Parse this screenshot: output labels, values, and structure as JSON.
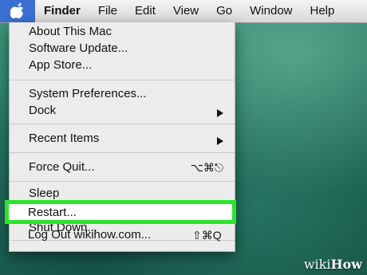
{
  "menubar": {
    "apple_icon": "apple-logo-icon",
    "items": [
      "Finder",
      "File",
      "Edit",
      "View",
      "Go",
      "Window",
      "Help"
    ]
  },
  "apple_menu": {
    "items": [
      {
        "label": "About This Mac"
      },
      {
        "label": "Software Update..."
      },
      {
        "label": "App Store..."
      },
      {
        "label": "System Preferences..."
      },
      {
        "label": "Dock",
        "submenu": true
      },
      {
        "label": "Recent Items",
        "submenu": true
      },
      {
        "label": "Force Quit...",
        "shortcut": "⌥⌘⎋"
      },
      {
        "label": "Sleep"
      },
      {
        "label": "Restart...",
        "highlighted": true
      },
      {
        "label": "Shut Down..."
      },
      {
        "label": "Log Out wikihow.com...",
        "shortcut": "⇧⌘Q"
      }
    ]
  },
  "highlight_color": "#2be52b",
  "watermark": {
    "part1": "wiki",
    "part2": "How"
  }
}
